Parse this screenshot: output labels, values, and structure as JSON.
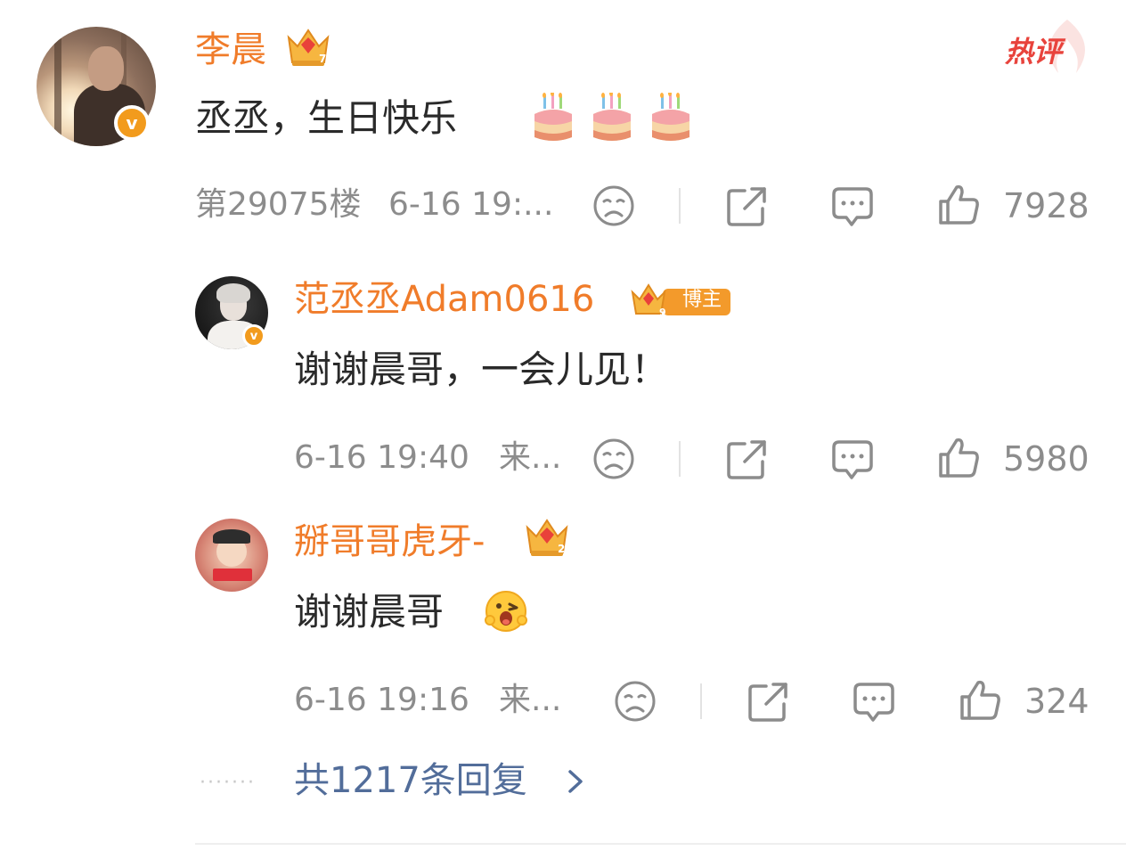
{
  "main_comment": {
    "username": "李晨",
    "hot_tag": "热评",
    "text": "丞丞，生日快乐",
    "emojis": [
      "cake-emoji",
      "cake-emoji",
      "cake-emoji"
    ],
    "floor": "第29075楼",
    "time": "6-16 19:...",
    "likes": "7928"
  },
  "replies": [
    {
      "username": "范丞丞Adam0616",
      "badge_label": "博主",
      "text": "谢谢晨哥，一会儿见！",
      "time": "6-16 19:40",
      "source": "来...",
      "likes": "5980"
    },
    {
      "username": "掰哥哥虎牙-",
      "text": "谢谢晨哥",
      "emoji": "laughing-face-emoji",
      "time": "6-16 19:16",
      "source": "来...",
      "likes": "324"
    }
  ],
  "more_replies": "共1217条回复",
  "colors": {
    "username": "#f07c2a",
    "hot": "#e8433c",
    "link": "#526d9a",
    "meta": "#8c8c8c",
    "verified": "#f29b1d"
  },
  "icons": [
    "dislike-icon",
    "share-icon",
    "comment-icon",
    "like-icon",
    "chevron-right-icon",
    "crown-badge-icon",
    "verified-icon"
  ]
}
